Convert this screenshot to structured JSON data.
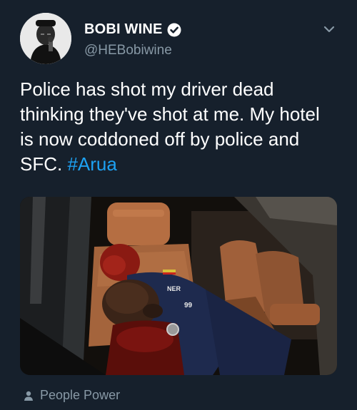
{
  "author": {
    "name": "BOBI WINE",
    "handle": "@HEBobiwine",
    "verified": true
  },
  "tweet": {
    "text": "Police has shot my driver dead thinking they've shot at me. My hotel is now coddoned off by police and SFC.",
    "hashtag": "#Arua"
  },
  "media": {
    "shirt_text": "NER",
    "jersey_number": "99"
  },
  "footer": {
    "label": "People Power",
    "icon": "person-icon"
  },
  "colors": {
    "background": "#16202c",
    "accent": "#1da1f2",
    "secondary_text": "#8899a6"
  }
}
